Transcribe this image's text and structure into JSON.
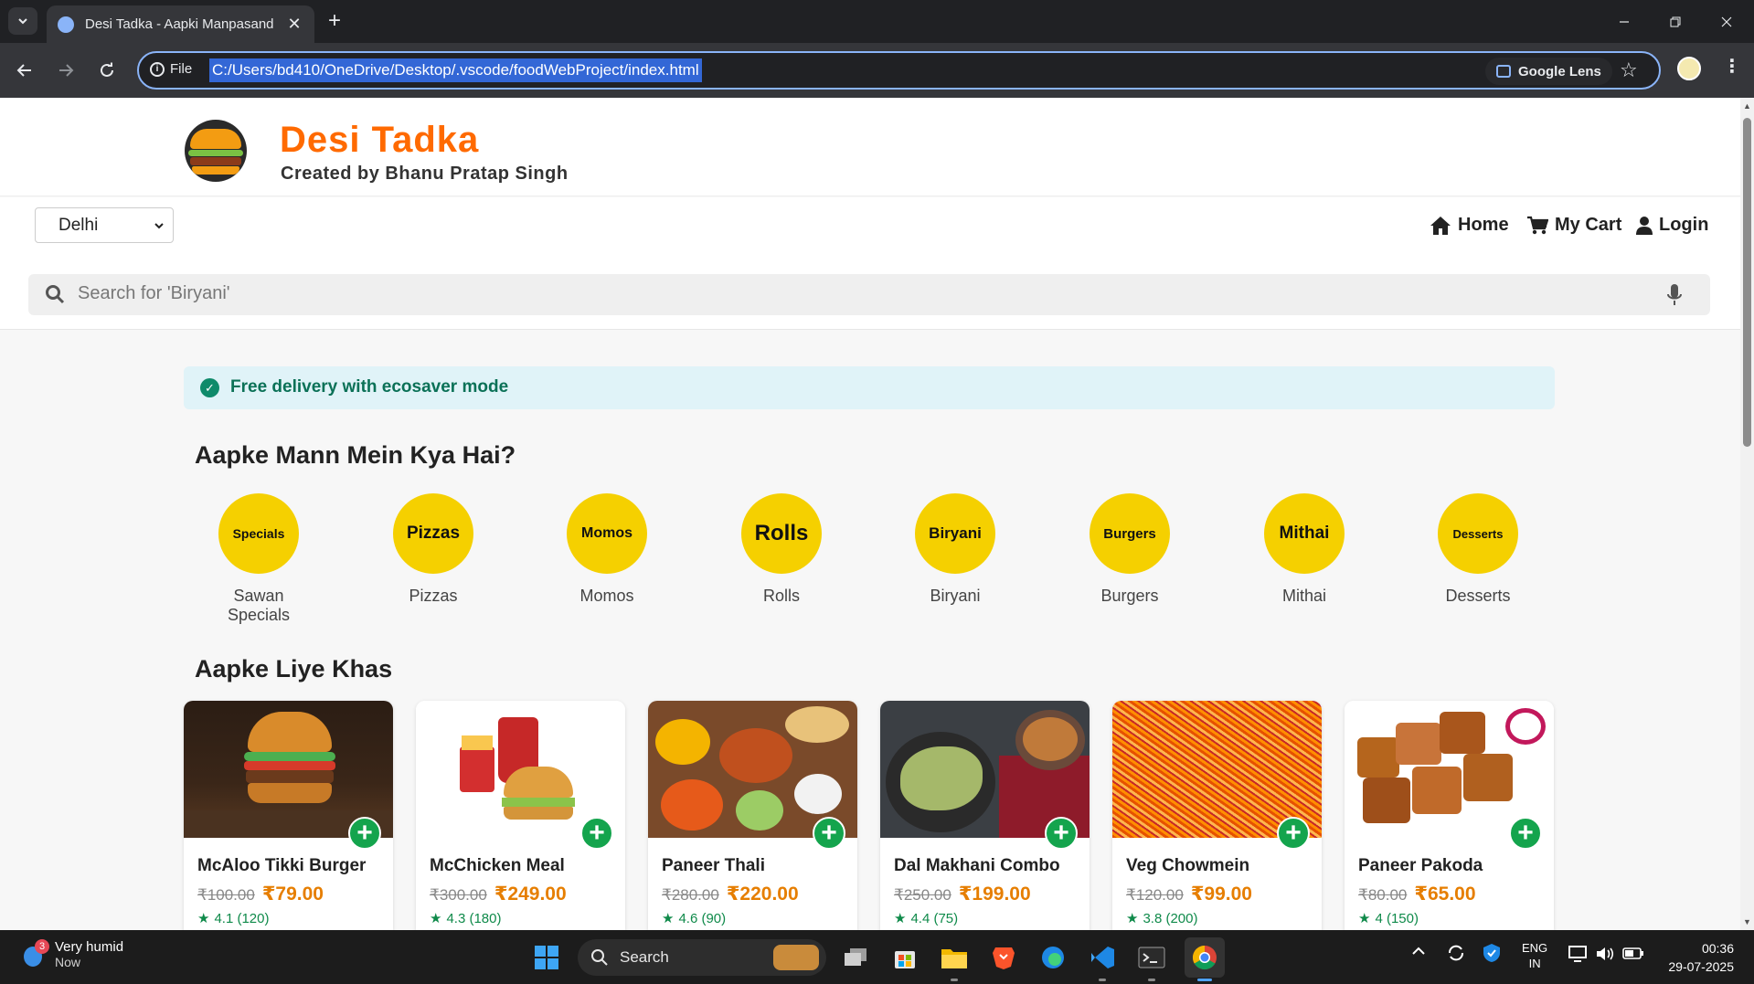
{
  "browser": {
    "tab_title": "Desi Tadka - Aapki Manpasand",
    "new_tab_label": "+",
    "close_tab_label": "✕",
    "scheme_label": "File",
    "url": "C:/Users/bd410/OneDrive/Desktop/.vscode/foodWebProject/index.html",
    "lens_label": "Google Lens"
  },
  "site": {
    "brand_title": "Desi Tadka",
    "brand_subtitle": "Created by Bhanu Pratap Singh",
    "city_selected": "Delhi",
    "nav": {
      "home": "Home",
      "cart": "My Cart",
      "login": "Login"
    },
    "search_placeholder": "Search for 'Biryani'",
    "offer_text": "Free delivery with ecosaver mode",
    "categories_title": "Aapke Mann Mein Kya Hai?",
    "categories": [
      {
        "circle": "Specials",
        "label": "Sawan Specials"
      },
      {
        "circle": "Pizzas",
        "label": "Pizzas"
      },
      {
        "circle": "Momos",
        "label": "Momos"
      },
      {
        "circle": "Rolls",
        "label": "Rolls"
      },
      {
        "circle": "Biryani",
        "label": "Biryani"
      },
      {
        "circle": "Burgers",
        "label": "Burgers"
      },
      {
        "circle": "Mithai",
        "label": "Mithai"
      },
      {
        "circle": "Desserts",
        "label": "Desserts"
      }
    ],
    "specials_title": "Aapke Liye Khas",
    "items": [
      {
        "name": "McAloo Tikki Burger",
        "old_price": "₹100.00",
        "price": "₹79.00",
        "rating": "4.1 (120)"
      },
      {
        "name": "McChicken Meal",
        "old_price": "₹300.00",
        "price": "₹249.00",
        "rating": "4.3 (180)"
      },
      {
        "name": "Paneer Thali",
        "old_price": "₹280.00",
        "price": "₹220.00",
        "rating": "4.6 (90)"
      },
      {
        "name": "Dal Makhani Combo",
        "old_price": "₹250.00",
        "price": "₹199.00",
        "rating": "4.4 (75)"
      },
      {
        "name": "Veg Chowmein",
        "old_price": "₹120.00",
        "price": "₹99.00",
        "rating": "3.8 (200)"
      },
      {
        "name": "Paneer Pakoda",
        "old_price": "₹80.00",
        "price": "₹65.00",
        "rating": "4 (150)"
      }
    ]
  },
  "taskbar": {
    "notification_count": "3",
    "weather_title": "Very humid",
    "weather_time": "Now",
    "search_label": "Search",
    "lang_line1": "ENG",
    "lang_line2": "IN",
    "time": "00:36",
    "date": "29-07-2025"
  },
  "colors": {
    "brand_orange": "#ff6a00",
    "category_yellow": "#f5d000",
    "add_green": "#14a44d",
    "price_orange": "#e67e00"
  }
}
